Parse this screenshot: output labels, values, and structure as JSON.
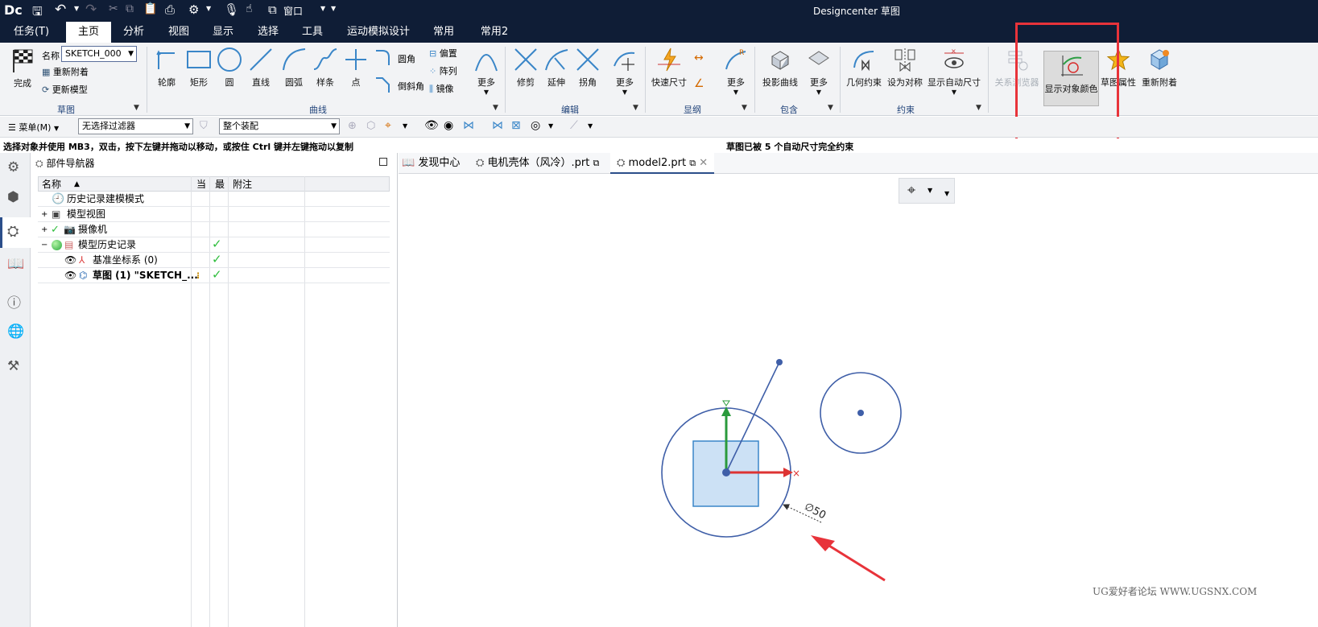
{
  "app": {
    "logo": "Dc",
    "title": "Designcenter 草图",
    "window_label": "窗口"
  },
  "menu": {
    "tabs": [
      "任务(T)",
      "主页",
      "分析",
      "视图",
      "显示",
      "选择",
      "工具",
      "运动模拟设计",
      "常用",
      "常用2"
    ],
    "active": "主页"
  },
  "ribbon": {
    "sketch": {
      "finish": "完成",
      "name_label": "名称",
      "name_value": "SKETCH_000",
      "reattach": "重新附着",
      "update_model": "更新模型",
      "group": "草图"
    },
    "curve": {
      "profile": "轮廓",
      "rectangle": "矩形",
      "circle": "圆",
      "line": "直线",
      "arc": "圆弧",
      "spline": "样条",
      "point": "点",
      "fillet": "圆角",
      "chamfer": "倒斜角",
      "offset": "偏置",
      "pattern": "阵列",
      "mirror": "镜像",
      "more": "更多",
      "group": "曲线"
    },
    "edit": {
      "trim": "修剪",
      "extend": "延伸",
      "corner": "拐角",
      "more": "更多",
      "group": "编辑"
    },
    "dimension": {
      "rapid": "快速尺寸",
      "more": "更多",
      "group": "显纲"
    },
    "include": {
      "project": "投影曲线",
      "more": "更多",
      "group": "包含"
    },
    "constraint": {
      "geometric": "几何约束",
      "make_symmetric": "设为对称",
      "show_auto_dim": "显示自动尺寸",
      "group": "约束"
    },
    "extra": {
      "relations": "关系浏览器",
      "show_object_color": "显示对象颜色",
      "sketch_props": "草图属性",
      "reattach": "重新附着"
    }
  },
  "toolbar2": {
    "menu": "菜单(M)",
    "filter": "无选择过滤器",
    "assembly": "整个装配"
  },
  "status": {
    "hint": "选择对象并使用 MB3，双击，按下左键并拖动以移动，或按住 Ctrl 键并左键拖动以复制",
    "message": "草图已被 5 个自动尺寸完全约束"
  },
  "navigator": {
    "title": "部件导航器",
    "columns": [
      "名称",
      "当",
      "最",
      "附注"
    ],
    "rows": [
      {
        "label": "历史记录建模模式"
      },
      {
        "label": "模型视图"
      },
      {
        "label": "摄像机"
      },
      {
        "label": "模型历史记录"
      },
      {
        "label": "基准坐标系 (0)"
      },
      {
        "label": "草图 (1) \"SKETCH_..."
      }
    ]
  },
  "doc_tabs": [
    "发现中心",
    "电机壳体（风冷）.prt",
    "model2.prt"
  ],
  "sketch": {
    "dimension": "∅50"
  },
  "watermark": "UG爱好者论坛 WWW.UGSNX.COM",
  "colors": {
    "title_bg": "#0f1d36",
    "sketch_blue": "#3f5fa8",
    "highlight_red": "#e8333a",
    "check_green": "#2ebd3c"
  }
}
